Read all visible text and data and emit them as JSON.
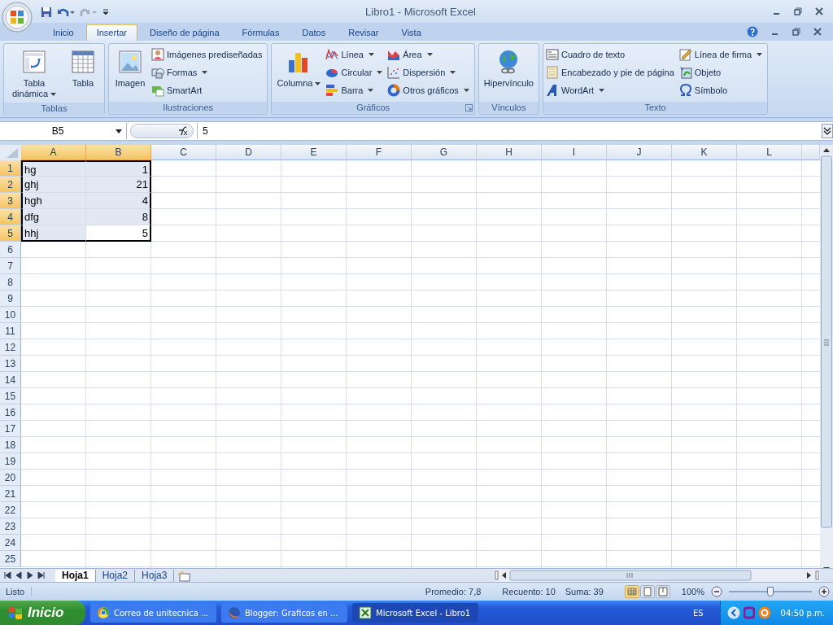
{
  "window": {
    "title": "Libro1 - Microsoft Excel"
  },
  "tabs": [
    {
      "label": "Inicio",
      "selected": false
    },
    {
      "label": "Insertar",
      "selected": true
    },
    {
      "label": "Diseño de página",
      "selected": false
    },
    {
      "label": "Fórmulas",
      "selected": false
    },
    {
      "label": "Datos",
      "selected": false
    },
    {
      "label": "Revisar",
      "selected": false
    },
    {
      "label": "Vista",
      "selected": false
    }
  ],
  "ribbon_groups": [
    {
      "label": "Tablas",
      "dialog_launcher": false,
      "large": [
        {
          "label": "Tabla dinámica",
          "dropdown": true
        },
        {
          "label": "Tabla",
          "dropdown": false
        }
      ]
    },
    {
      "label": "Ilustraciones",
      "dialog_launcher": false,
      "large": [
        {
          "label": "Imagen",
          "dropdown": false
        }
      ],
      "columns": [
        [
          {
            "label": "Imágenes prediseñadas",
            "dropdown": false
          },
          {
            "label": "Formas",
            "dropdown": true
          },
          {
            "label": "SmartArt",
            "dropdown": false
          }
        ]
      ]
    },
    {
      "label": "Gráficos",
      "dialog_launcher": true,
      "large": [
        {
          "label": "Columna",
          "dropdown": true
        }
      ],
      "columns": [
        [
          {
            "label": "Línea",
            "dropdown": true
          },
          {
            "label": "Circular",
            "dropdown": true
          },
          {
            "label": "Barra",
            "dropdown": true
          }
        ],
        [
          {
            "label": "Área",
            "dropdown": true
          },
          {
            "label": "Dispersión",
            "dropdown": true
          },
          {
            "label": "Otros gráficos",
            "dropdown": true
          }
        ]
      ]
    },
    {
      "label": "Vínculos",
      "dialog_launcher": false,
      "large": [
        {
          "label": "Hipervínculo",
          "dropdown": false
        }
      ]
    },
    {
      "label": "Texto",
      "dialog_launcher": false,
      "columns": [
        [
          {
            "label": "Cuadro de texto",
            "dropdown": false
          },
          {
            "label": "Encabezado y pie de página",
            "dropdown": false
          },
          {
            "label": "WordArt",
            "dropdown": true
          }
        ],
        [
          {
            "label": "Línea de firma",
            "dropdown": true
          },
          {
            "label": "Objeto",
            "dropdown": false
          },
          {
            "label": "Símbolo",
            "dropdown": false
          }
        ]
      ]
    }
  ],
  "formula_bar": {
    "name_box": "B5",
    "formula": "5"
  },
  "columns": [
    {
      "label": "A",
      "selected": true
    },
    {
      "label": "B",
      "selected": true
    },
    {
      "label": "C",
      "selected": false
    },
    {
      "label": "D",
      "selected": false
    },
    {
      "label": "E",
      "selected": false
    },
    {
      "label": "F",
      "selected": false
    },
    {
      "label": "G",
      "selected": false
    },
    {
      "label": "H",
      "selected": false
    },
    {
      "label": "I",
      "selected": false
    },
    {
      "label": "J",
      "selected": false
    },
    {
      "label": "K",
      "selected": false
    },
    {
      "label": "L",
      "selected": false
    }
  ],
  "rows": [
    {
      "header": "1",
      "selected": true,
      "cells": [
        {
          "value": "hg",
          "kind": "text",
          "selected": true,
          "active": false
        },
        {
          "value": "1",
          "kind": "number",
          "selected": true,
          "active": false
        }
      ]
    },
    {
      "header": "2",
      "selected": true,
      "cells": [
        {
          "value": "ghj",
          "kind": "text",
          "selected": true,
          "active": false
        },
        {
          "value": "21",
          "kind": "number",
          "selected": true,
          "active": false
        }
      ]
    },
    {
      "header": "3",
      "selected": true,
      "cells": [
        {
          "value": "hgh",
          "kind": "text",
          "selected": true,
          "active": false
        },
        {
          "value": "4",
          "kind": "number",
          "selected": true,
          "active": false
        }
      ]
    },
    {
      "header": "4",
      "selected": true,
      "cells": [
        {
          "value": "dfg",
          "kind": "text",
          "selected": true,
          "active": false
        },
        {
          "value": "8",
          "kind": "number",
          "selected": true,
          "active": false
        }
      ]
    },
    {
      "header": "5",
      "selected": true,
      "cells": [
        {
          "value": "hhj",
          "kind": "text",
          "selected": true,
          "active": false
        },
        {
          "value": "5",
          "kind": "number",
          "selected": true,
          "active": true
        }
      ]
    },
    {
      "header": "6",
      "selected": false
    },
    {
      "header": "7",
      "selected": false
    },
    {
      "header": "8",
      "selected": false
    },
    {
      "header": "9",
      "selected": false
    },
    {
      "header": "10",
      "selected": false
    },
    {
      "header": "11",
      "selected": false
    },
    {
      "header": "12",
      "selected": false
    },
    {
      "header": "13",
      "selected": false
    },
    {
      "header": "14",
      "selected": false
    },
    {
      "header": "15",
      "selected": false
    },
    {
      "header": "16",
      "selected": false
    },
    {
      "header": "17",
      "selected": false
    },
    {
      "header": "18",
      "selected": false
    },
    {
      "header": "19",
      "selected": false
    },
    {
      "header": "20",
      "selected": false
    },
    {
      "header": "21",
      "selected": false
    },
    {
      "header": "22",
      "selected": false
    },
    {
      "header": "23",
      "selected": false
    },
    {
      "header": "24",
      "selected": false
    },
    {
      "header": "25",
      "selected": false
    }
  ],
  "sheet_tabs": [
    {
      "label": "Hoja1",
      "selected": true
    },
    {
      "label": "Hoja2",
      "selected": false
    },
    {
      "label": "Hoja3",
      "selected": false
    }
  ],
  "status_bar": {
    "state": "Listo",
    "average": "Promedio: 7,8",
    "count": "Recuento: 10",
    "sum": "Suma: 39",
    "views": [
      {
        "selected": true
      },
      {
        "selected": false
      },
      {
        "selected": false
      }
    ],
    "zoom": "100%",
    "zoom_slider": {
      "level": 0.5
    }
  },
  "taskbar": {
    "start": "Inicio",
    "tasks": [
      {
        "label": "Correo de unitecnica ...",
        "selected": false
      },
      {
        "label": "Blogger: Graficos en ...",
        "selected": false
      },
      {
        "label": "Microsoft Excel - Libro1",
        "selected": true
      }
    ],
    "language": "ES",
    "clock": "04:50 p.m."
  }
}
